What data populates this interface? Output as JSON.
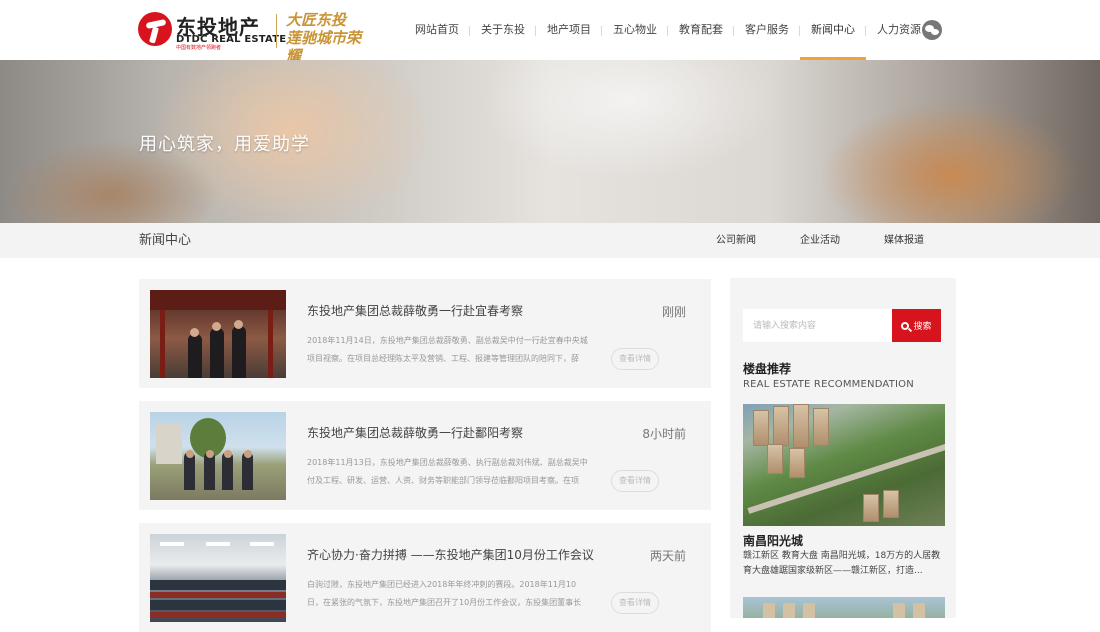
{
  "header": {
    "logo_cn": "东投地产",
    "logo_en": "DTDC REAL ESTATE",
    "logo_sub": "中国有数地产领跑者",
    "slogan": "大匠东投 莲驰城市荣耀",
    "nav": [
      {
        "label": "网站首页"
      },
      {
        "label": "关于东投"
      },
      {
        "label": "地产项目"
      },
      {
        "label": "五心物业"
      },
      {
        "label": "教育配套"
      },
      {
        "label": "客户服务"
      },
      {
        "label": "新闻中心",
        "active": true
      },
      {
        "label": "人力资源"
      }
    ]
  },
  "banner": {
    "title": "用心筑家，用爱助学"
  },
  "subbar": {
    "title": "新闻中心",
    "tabs": [
      {
        "label": "公司新闻"
      },
      {
        "label": "企业活动"
      },
      {
        "label": "媒体报道"
      }
    ]
  },
  "news": [
    {
      "title": "东投地产集团总裁薛敬勇一行赴宜春考察",
      "time": "刚刚",
      "summary": "2018年11月14日，东投地产集团总裁薛敬勇、副总裁吴中付一行赴宜春中央城项目视察。在项目总经理陈太平及营销、工程、报建等管理团队的陪同下，薛",
      "button": "查看详情"
    },
    {
      "title": "东投地产集团总裁薛敬勇一行赴鄱阳考察",
      "time": "8小时前",
      "summary": "2018年11月13日，东投地产集团总裁薛敬勇、执行副总裁刘伟斌、副总裁吴中付及工程、研发、运营、人资、财务等职能部门领导莅临鄱阳项目考察。在项",
      "button": "查看详情"
    },
    {
      "title": "齐心协力·奋力拼搏 ——东投地产集团10月份工作会议",
      "time": "两天前",
      "summary": "白驹过隙，东投地产集团已经进入2018年年终冲刺的赛段。2018年11月10日，在紧张的气氛下，东投地产集团召开了10月份工作会议，东投集团董事长陈东",
      "button": "查看详情"
    }
  ],
  "sidebar": {
    "search_placeholder": "请输入搜索内容",
    "search_button": "搜索",
    "rec_title": "楼盘推荐",
    "rec_subtitle": "REAL ESTATE RECOMMENDATION",
    "property_name": "南昌阳光城",
    "property_desc": "赣江新区 教育大盘 南昌阳光城，18万方的人居教育大盘雄踞国家级新区——赣江新区，打造..."
  },
  "colors": {
    "brand_red": "#d7141d",
    "nav_active": "#f0a235",
    "slogan_gold": "#c99434"
  },
  "icons": {
    "search": "search-icon",
    "wechat": "wechat-icon",
    "logo": "dtdc-logo-icon"
  }
}
